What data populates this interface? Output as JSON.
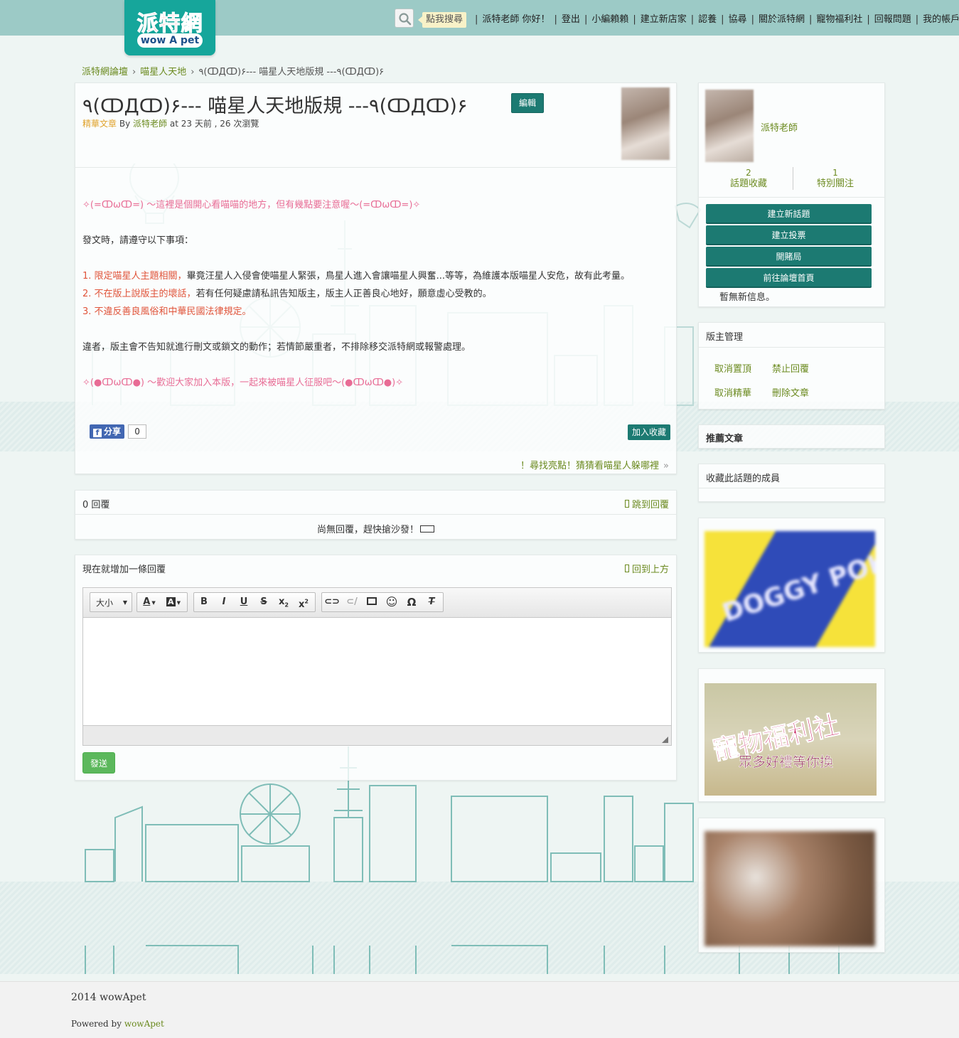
{
  "brand": {
    "logo_cn": "派特網",
    "logo_en": "wow A pet"
  },
  "header": {
    "search_tip": "點我搜尋",
    "greeting": "派特老師 你好！",
    "nav": [
      "登出",
      "小編賴賴",
      "建立新店家",
      "認養",
      "協尋",
      "關於派特網",
      "寵物福利社",
      "回報問題",
      "我的帳戶"
    ]
  },
  "breadcrumb": {
    "items": [
      "派特網論壇",
      "喵星人天地"
    ],
    "current": "٩(ↀДↀ)۶--- 喵星人天地版規 ---٩(ↀДↀ)۶"
  },
  "post": {
    "title": "٩(ↀДↀ)۶--- 喵星人天地版規 ---٩(ↀДↀ)۶",
    "edit_label": "編輯",
    "meta_tag": "精華文章",
    "meta_by": "By",
    "meta_author": "派特老師",
    "meta_rest": "at 23 天前 , 26 次瀏覽",
    "intro": "✧(=ↀωↀ=) ～這裡是個開心看喵喵的地方，但有幾點要注意喔～(=ↀωↀ=)✧",
    "lead": "發文時，請遵守以下事項：",
    "rules": [
      {
        "num": "1.",
        "hl": "限定喵星人主題相關，",
        "rest": "畢竟汪星人入侵會使喵星人緊張，鳥星人進入會讓喵星人興奮...等等，為維護本版喵星人安危，故有此考量。"
      },
      {
        "num": "2.",
        "hl": "不在版上說版主的壞話，",
        "rest": "若有任何疑慮請私訊告知版主，版主人正善良心地好，願意虛心受教的。"
      },
      {
        "num": "3.",
        "hl": "不違反善良風俗和中華民國法律規定。",
        "rest": ""
      }
    ],
    "penalty": "違者，版主會不告知就進行刪文或鎖文的動作；若情節嚴重者，不排除移交派特網或報警處理。",
    "outro": "✧(●ↀωↀ●) ～歡迎大家加入本版，一起來被喵星人征服吧～(●ↀωↀ●)✧",
    "share_label": "分享",
    "share_count": "0",
    "fav_label": "加入收藏",
    "next_link": "！尋找亮點！猜猜看喵星人躲哪裡",
    "next_arrow": "»"
  },
  "replies": {
    "count_label": "0 回覆",
    "jump_label": "跳到回覆",
    "empty_text": "尚無回覆，趕快搶沙發！"
  },
  "reply_form": {
    "title": "現在就增加一條回覆",
    "top_label": "回到上方",
    "size_label": "大小",
    "send_label": "發送"
  },
  "sidebar": {
    "username": "派特老師",
    "stats": [
      {
        "value": "2",
        "label": "話題收藏"
      },
      {
        "value": "1",
        "label": "特別關注"
      }
    ],
    "buttons": [
      "建立新話題",
      "建立投票",
      "開賭局",
      "前往論壇首頁"
    ],
    "no_messages": "暫無新信息。",
    "mod_title": "版主管理",
    "mod_links": [
      "取消置頂",
      "禁止回覆",
      "取消精華",
      "刪除文章"
    ],
    "recommended_title": "推薦文章",
    "members_title": "收藏此話題的成員",
    "ad1_text": "DOGGY POKY",
    "ad2_title": "寵物福利社",
    "ad2_sub": "眾多好禮等你換"
  },
  "footer": {
    "copyright": "2014 wowApet",
    "powered_prefix": "Powered by",
    "powered_name": "wowApet"
  },
  "colors": {
    "topbar": "#9ccac6",
    "teal_button": "#1c7a72",
    "link_green": "#6b8a1f",
    "pink_text": "#e86c95",
    "red_text": "#e0543a",
    "send_green": "#5cb85c"
  }
}
